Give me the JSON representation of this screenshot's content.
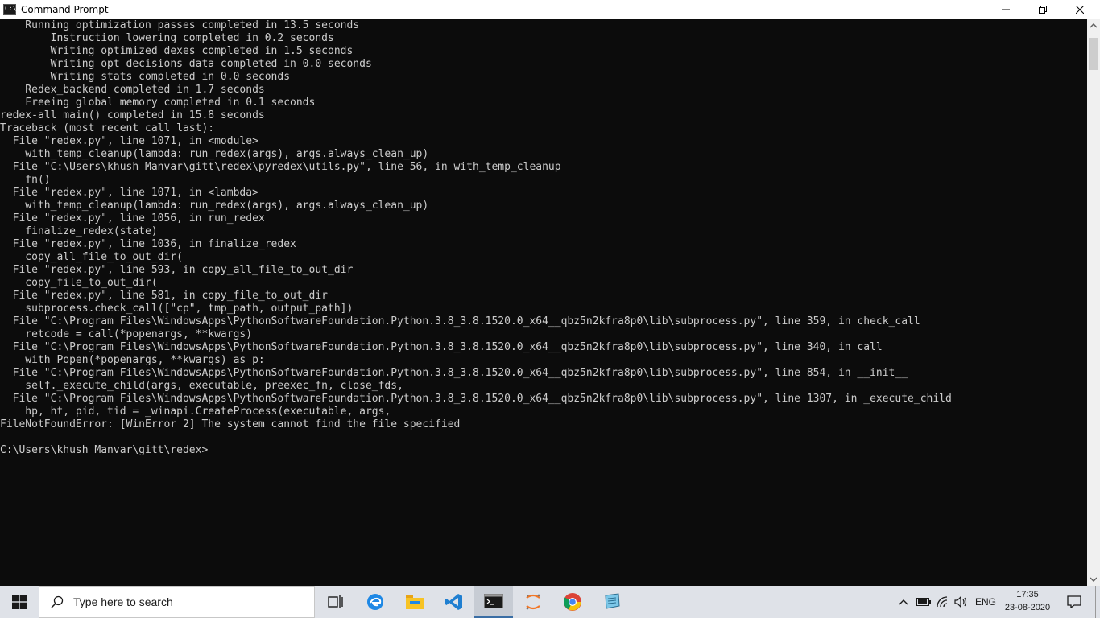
{
  "window": {
    "title": "Command Prompt",
    "app_icon_label": "C:\\",
    "controls": {
      "minimize": "minimize-icon",
      "maximize": "maximize-icon",
      "close": "close-icon"
    }
  },
  "console": {
    "lines": [
      "    Running optimization passes completed in 13.5 seconds",
      "        Instruction lowering completed in 0.2 seconds",
      "        Writing optimized dexes completed in 1.5 seconds",
      "        Writing opt decisions data completed in 0.0 seconds",
      "        Writing stats completed in 0.0 seconds",
      "    Redex_backend completed in 1.7 seconds",
      "    Freeing global memory completed in 0.1 seconds",
      "redex-all main() completed in 15.8 seconds",
      "Traceback (most recent call last):",
      "  File \"redex.py\", line 1071, in <module>",
      "    with_temp_cleanup(lambda: run_redex(args), args.always_clean_up)",
      "  File \"C:\\Users\\khush Manvar\\gitt\\redex\\pyredex\\utils.py\", line 56, in with_temp_cleanup",
      "    fn()",
      "  File \"redex.py\", line 1071, in <lambda>",
      "    with_temp_cleanup(lambda: run_redex(args), args.always_clean_up)",
      "  File \"redex.py\", line 1056, in run_redex",
      "    finalize_redex(state)",
      "  File \"redex.py\", line 1036, in finalize_redex",
      "    copy_all_file_to_out_dir(",
      "  File \"redex.py\", line 593, in copy_all_file_to_out_dir",
      "    copy_file_to_out_dir(",
      "  File \"redex.py\", line 581, in copy_file_to_out_dir",
      "    subprocess.check_call([\"cp\", tmp_path, output_path])",
      "  File \"C:\\Program Files\\WindowsApps\\PythonSoftwareFoundation.Python.3.8_3.8.1520.0_x64__qbz5n2kfra8p0\\lib\\subprocess.py\", line 359, in check_call",
      "    retcode = call(*popenargs, **kwargs)",
      "  File \"C:\\Program Files\\WindowsApps\\PythonSoftwareFoundation.Python.3.8_3.8.1520.0_x64__qbz5n2kfra8p0\\lib\\subprocess.py\", line 340, in call",
      "    with Popen(*popenargs, **kwargs) as p:",
      "  File \"C:\\Program Files\\WindowsApps\\PythonSoftwareFoundation.Python.3.8_3.8.1520.0_x64__qbz5n2kfra8p0\\lib\\subprocess.py\", line 854, in __init__",
      "    self._execute_child(args, executable, preexec_fn, close_fds,",
      "  File \"C:\\Program Files\\WindowsApps\\PythonSoftwareFoundation.Python.3.8_3.8.1520.0_x64__qbz5n2kfra8p0\\lib\\subprocess.py\", line 1307, in _execute_child",
      "    hp, ht, pid, tid = _winapi.CreateProcess(executable, args,",
      "FileNotFoundError: [WinError 2] The system cannot find the file specified",
      "",
      "C:\\Users\\khush Manvar\\gitt\\redex>"
    ]
  },
  "taskbar": {
    "search_placeholder": "Type here to search",
    "apps": [
      "task-view-icon",
      "edge-icon",
      "file-explorer-icon",
      "vscode-icon",
      "command-prompt-icon",
      "jupyter-icon",
      "chrome-icon",
      "notepad-icon"
    ],
    "tray": {
      "language": "ENG",
      "time": "17:35",
      "date": "23-08-2020"
    }
  },
  "colors": {
    "console_bg": "#0c0c0c",
    "console_text": "#cccccc",
    "taskbar_bg": "#dfe2e8",
    "accent": "#3a6ea5"
  }
}
